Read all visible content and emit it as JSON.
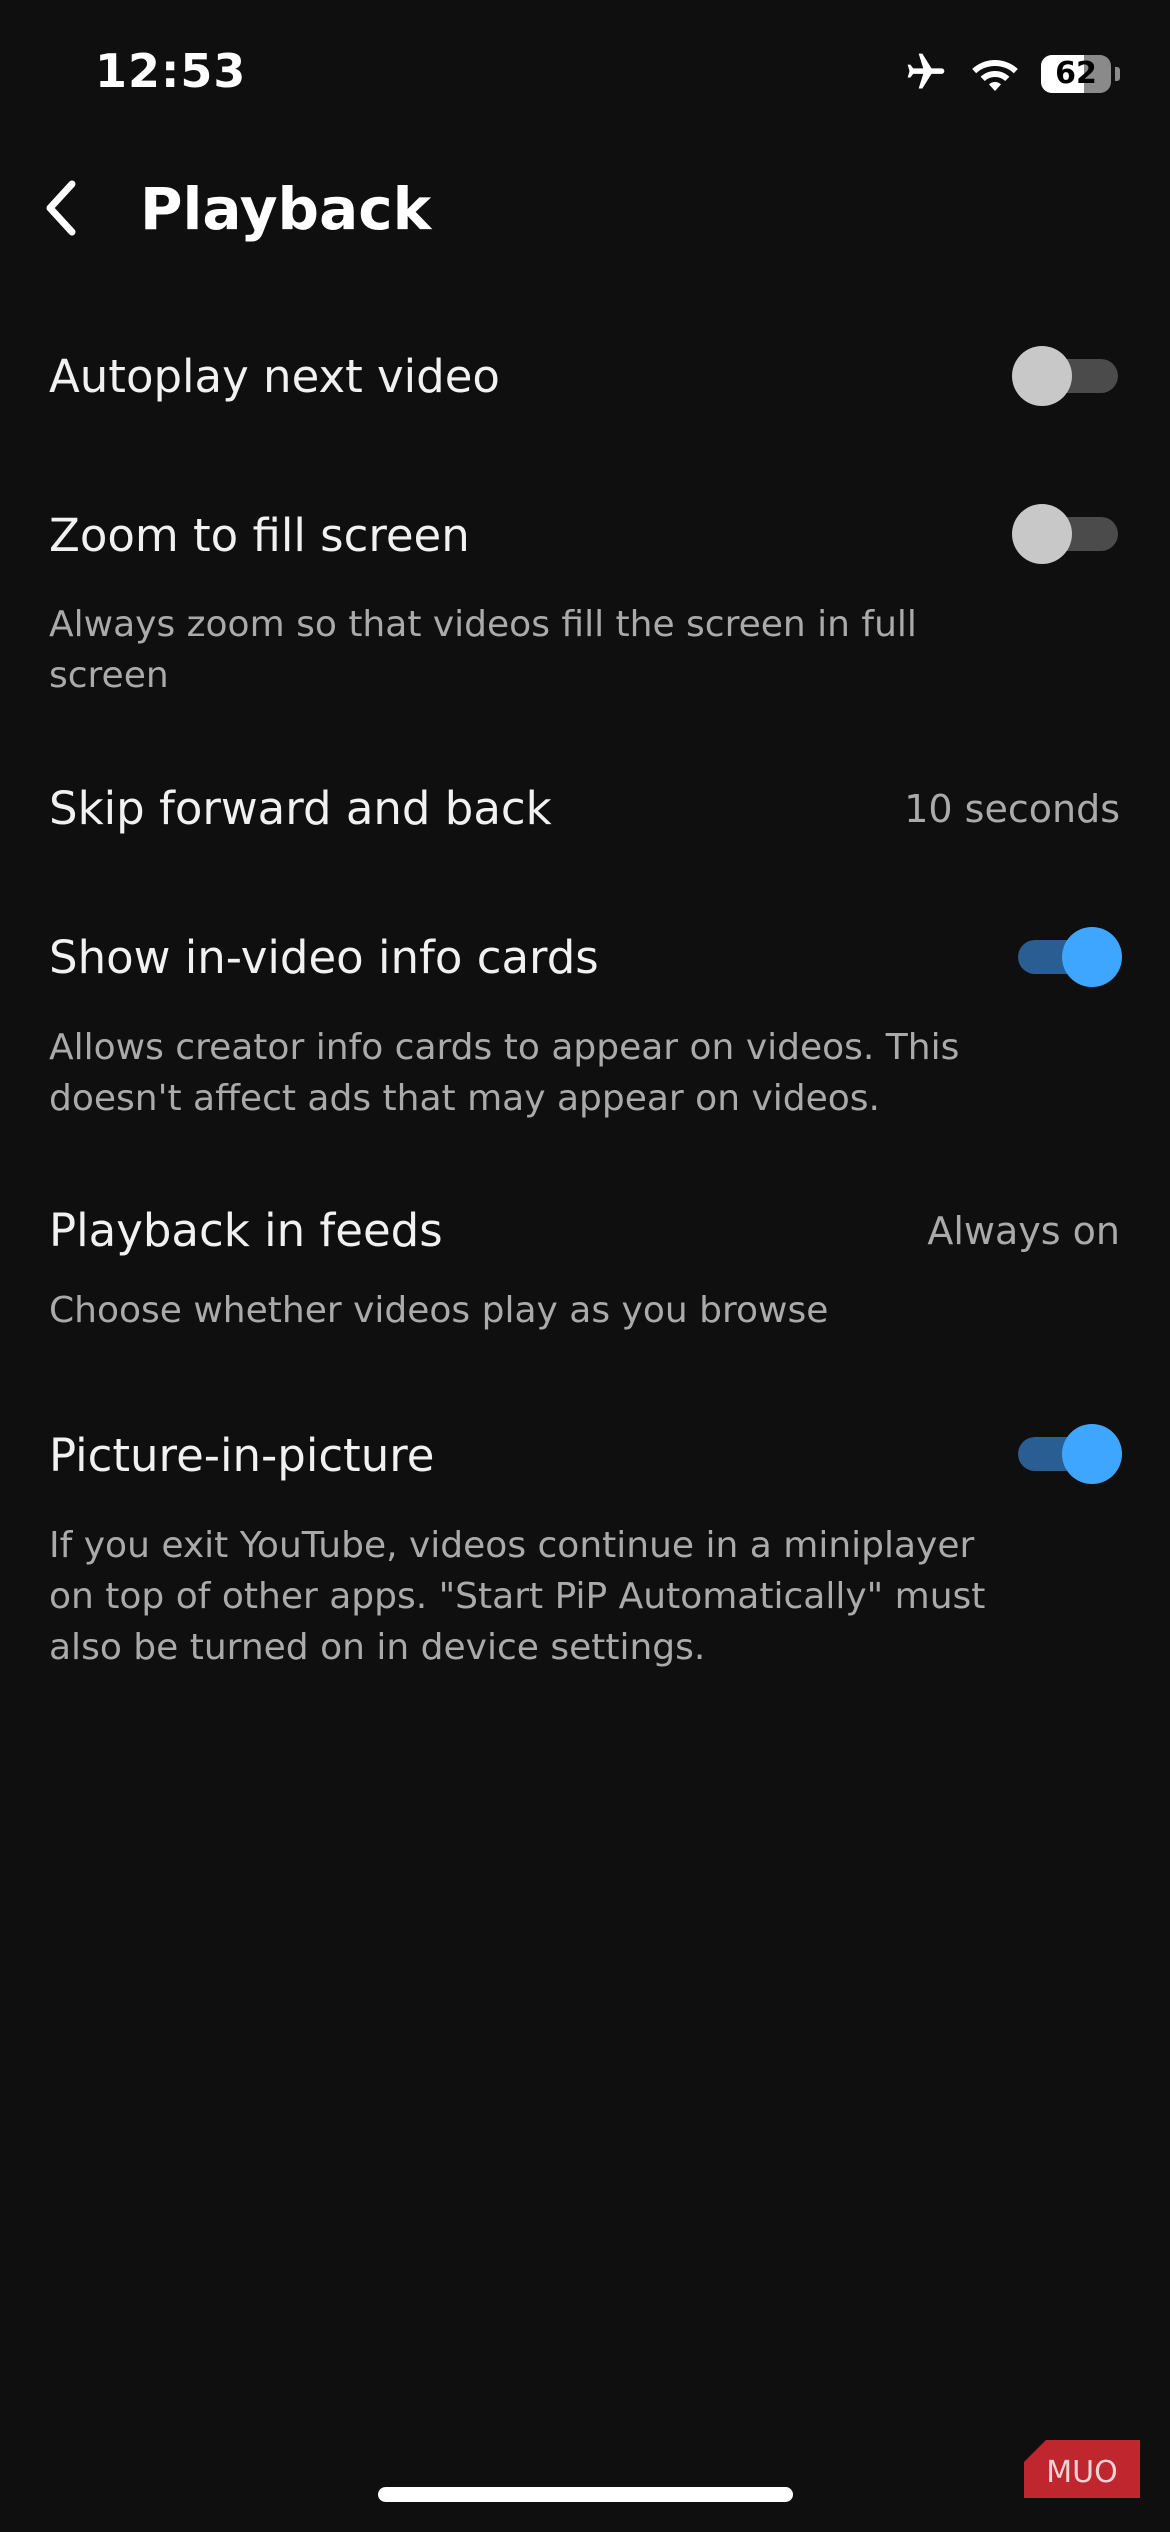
{
  "status_bar": {
    "time": "12:53",
    "battery_percent": 62,
    "icons": [
      "airplane-icon",
      "wifi-icon",
      "battery-icon"
    ]
  },
  "header": {
    "back_icon": "chevron-left-icon",
    "title": "Playback"
  },
  "settings": [
    {
      "title": "Autoplay next video",
      "type": "toggle",
      "enabled": false
    },
    {
      "title": "Zoom to fill screen",
      "description": "Always zoom so that videos fill the screen in full screen",
      "type": "toggle",
      "enabled": false
    },
    {
      "title": "Skip forward and back",
      "type": "value",
      "value": "10 seconds"
    },
    {
      "title": "Show in-video info cards",
      "description": "Allows creator info cards to appear on videos. This doesn't affect ads that may appear on videos.",
      "type": "toggle",
      "enabled": true
    },
    {
      "title": "Playback in feeds",
      "description": "Choose whether videos play as you browse",
      "type": "value",
      "value": "Always on"
    },
    {
      "title": "Picture-in-picture",
      "description": "If you exit YouTube, videos continue in a miniplayer on top of other apps. \"Start PiP Automatically\" must also be turned on in device settings.",
      "type": "toggle",
      "enabled": true
    }
  ],
  "watermark": {
    "text": "MUO",
    "color": "#c0262d"
  },
  "colors": {
    "background": "#0f0f0f",
    "toggle_on_thumb": "#3ea6ff",
    "toggle_on_track": "#2a5e92",
    "toggle_off_thumb": "#c8c8c8",
    "toggle_off_track": "#4b4b4b"
  }
}
